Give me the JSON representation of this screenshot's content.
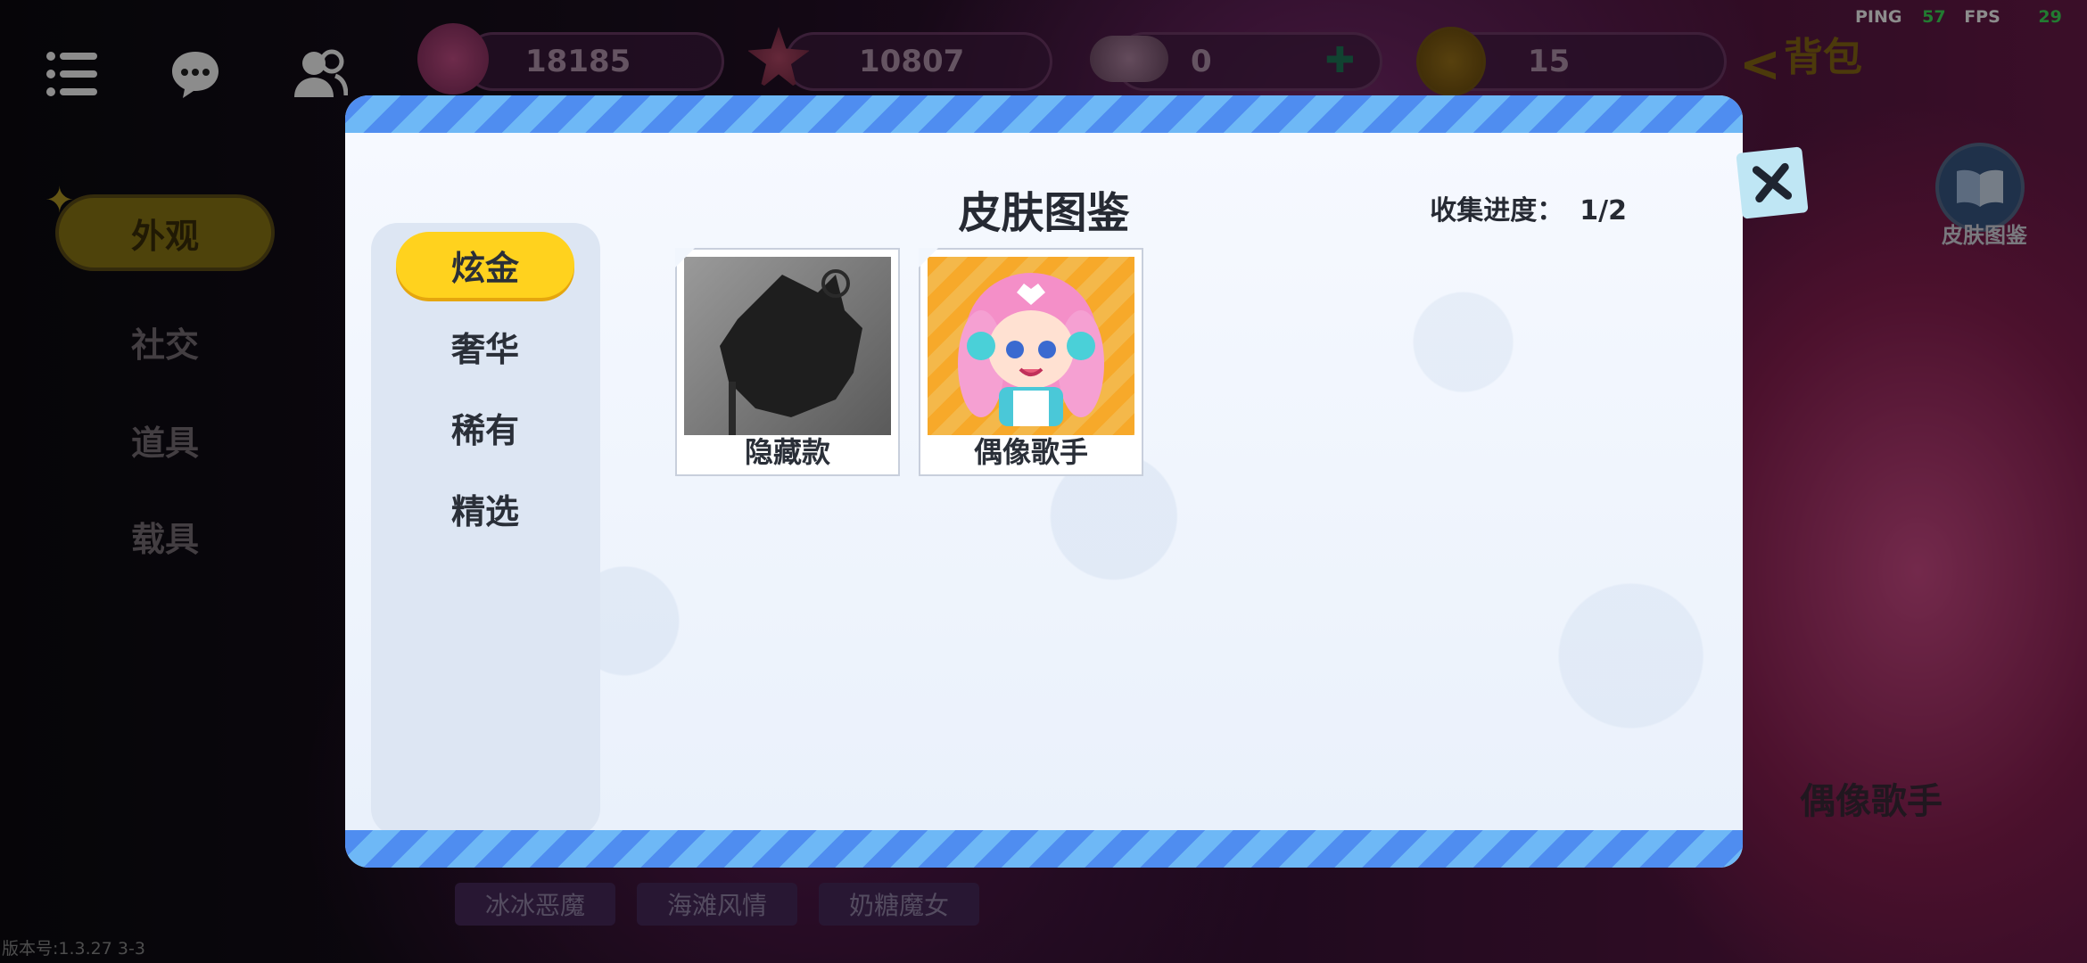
{
  "hud": {
    "ping_label": "PING",
    "ping_value": "57",
    "fps_label": "FPS",
    "fps_value": "29",
    "currencies": [
      {
        "icon": "lollipop-icon",
        "value": "18185"
      },
      {
        "icon": "star-flower-icon",
        "value": "10807"
      },
      {
        "icon": "gem-pile-icon",
        "value": "0"
      },
      {
        "icon": "bunny-coin-icon",
        "value": "15"
      }
    ],
    "bag_label": "背包"
  },
  "left_nav": {
    "items": [
      "外观",
      "社交",
      "道具",
      "载具"
    ],
    "active_index": 0
  },
  "bottom_tags": [
    "冰冰恶魔",
    "海滩风情",
    "奶糖魔女"
  ],
  "side": {
    "skin_book_label": "皮肤图鉴",
    "character_name": "偶像歌手"
  },
  "version": "版本号:1.3.27 3-3",
  "modal": {
    "title": "皮肤图鉴",
    "progress_label": "收集进度：",
    "progress_value": "1/2",
    "categories": [
      "炫金",
      "奢华",
      "稀有",
      "精选"
    ],
    "active_category": 0,
    "skins": [
      {
        "name": "隐藏款",
        "locked": true
      },
      {
        "name": "偶像歌手",
        "locked": false
      }
    ]
  },
  "colors": {
    "accent_yellow": "#ffd21e",
    "stripe_blue": "#4f8df0",
    "stripe_light": "#6eb8f6"
  }
}
